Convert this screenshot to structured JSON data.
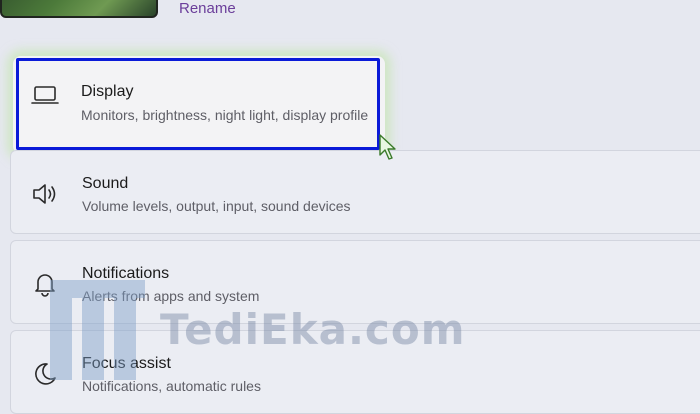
{
  "header": {
    "rename_label": "Rename"
  },
  "settings": {
    "items": [
      {
        "title": "Display",
        "subtitle": "Monitors, brightness, night light, display profile",
        "icon": "display-laptop-icon"
      },
      {
        "title": "Sound",
        "subtitle": "Volume levels, output, input, sound devices",
        "icon": "speaker-icon"
      },
      {
        "title": "Notifications",
        "subtitle": "Alerts from apps and system",
        "icon": "bell-icon"
      },
      {
        "title": "Focus assist",
        "subtitle": "Notifications, automatic rules",
        "icon": "moon-icon"
      }
    ]
  },
  "watermark": {
    "text": "TediEka.com"
  },
  "colors": {
    "focus_outline": "#0a1ad8",
    "rename_link": "#6b3e9a",
    "glow": "#bee6a0"
  }
}
